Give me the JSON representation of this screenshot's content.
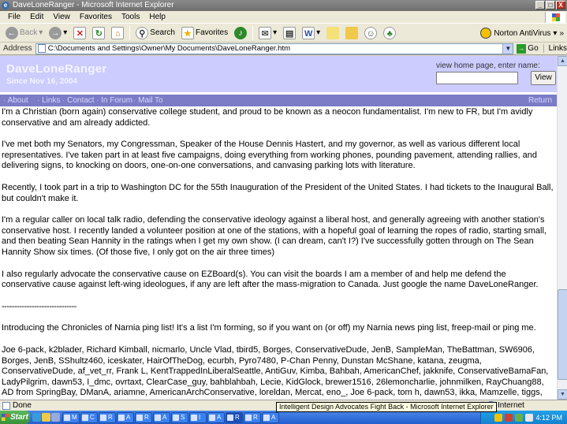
{
  "window": {
    "title": "DaveLoneRanger - Microsoft Internet Explorer",
    "buttons": [
      "_",
      "□",
      "X"
    ]
  },
  "menu": [
    "File",
    "Edit",
    "View",
    "Favorites",
    "Tools",
    "Help"
  ],
  "toolbar": {
    "back": "Back",
    "search": "Search",
    "favorites": "Favorites",
    "norton": "Norton AntiVirus"
  },
  "address": {
    "label": "Address",
    "value": "C:\\Documents and Settings\\Owner\\My Documents\\DaveLoneRanger.htm",
    "go": "Go",
    "links": "Links"
  },
  "page": {
    "title": "DaveLoneRanger",
    "since": "Since Nov 16, 2004",
    "view_home_label": "view home page, enter name:",
    "view_button": "View",
    "nav": [
      "About",
      "Links",
      "Contact",
      "In Forum",
      "Mail To"
    ],
    "nav_right": "Return",
    "paragraphs": [
      "I'm a Christian (born again) conservative college student, and proud to be known as a neocon fundamentalist. I'm new to FR, but I'm avidly conservative and am already addicted.",
      "I've met both my Senators, my Congressman, Speaker of the House Dennis Hastert, and my governor, as well as various different local representatives. I've taken part in at least five campaigns, doing everything from working phones, pounding pavement, attending rallies, and delivering signs, to knocking on doors, one-on-one conversations, and canvasing parking lots with literature.",
      "Recently, I took part in a trip to Washington DC for the 55th Inauguration of the President of the United States. I had tickets to the Inaugural Ball, but couldn't make it.",
      "I'm a regular caller on local talk radio, defending the conservative ideology against a liberal host, and generally agreeing with another station's conservative host. I recently landed a volunteer position at one of the stations, with a hopeful goal of learning the ropes of radio, starting small, and then beating Sean Hannity in the ratings when I get my own show. (I can dream, can't I?) I've successfully gotten through on The Sean Hannity Show six times. (Of those five, I only got on the air three times)",
      "I also regularly advocate the conservative cause on EZBoard(s). You can visit the boards I am a member of and help me defend the conservative cause against left-wing ideologues, if any are left after the mass-migration to Canada. Just google the name DaveLoneRanger.",
      "------------------------------",
      "Introducing the Chronicles of Narnia ping list! It's a list I'm forming, so if you want on (or off) my Narnia news ping list, freep-mail or ping me.",
      "Joe 6-pack, k2blader, Richard Kimball, nicmarlo, Uncle Vlad, tbird5, Borges, ConservativeDude, JenB, SampleMan, TheBattman, SW6906, Borges, JenB, SShultz460, iceskater, HairOfTheDog, ecurbh, Pyro7480, P-Chan Penny, Dunstan McShane, katana, zeugma, ConservativeDude, af_vet_rr, Frank L, KentTrappedInLiberalSeattle, AntiGuv, Kimba, Bahbah, AmericanChef, jakknife, ConservativeBamaFan, LadyPilgrim, dawn53, I_dmc, ovrtaxt, ClearCase_guy, bahblahbah, Lecie, KidGlock, brewer1516, 26lemoncharlie, johnmilken, RayChuang88, AD from SpringBay, DManA, ariamne, AmericanArchConservative, loreldan, Mercat, eno_, Joe 6-pack, tom h, dawn53, ikka, Mamzelle, tiggs, GretchenM, kalee, techgal, GatorGirl, tiamat, kevkrom, Prince Caspian, abner, msp2004, BigBadWolf, girlscout, TitanicMan2003, Soul Seeker"
    ]
  },
  "status": {
    "text": "Done",
    "zone": "Internet"
  },
  "taskbar": {
    "start": "Start",
    "tasks": [
      "M",
      "C",
      "R",
      "A",
      "R",
      "A",
      "S",
      "I",
      "A",
      "R",
      "R",
      "A"
    ],
    "clock": "4:12 PM"
  },
  "tooltip": "Intelligent Design Advocates Fight Back - Microsoft Internet Explorer",
  "colors": {
    "header_bg": "#ccccff",
    "nav_bg": "#7b7bc6",
    "taskbar": "#245fd0"
  }
}
